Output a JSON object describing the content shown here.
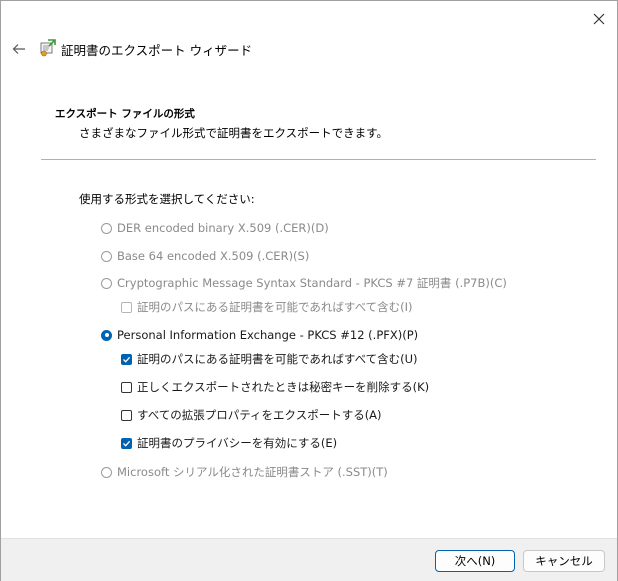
{
  "window": {
    "close_icon": "close-icon",
    "back_icon": "back-arrow-icon"
  },
  "header": {
    "icon": "certificate-export-icon",
    "title": "証明書のエクスポート ウィザード"
  },
  "section": {
    "title": "エクスポート ファイルの形式",
    "description": "さまざまなファイル形式で証明書をエクスポートできます。"
  },
  "prompt": "使用する形式を選択してください:",
  "options": {
    "der": {
      "label": "DER encoded binary X.509 (.CER)(D)",
      "selected": false,
      "enabled": false
    },
    "base64": {
      "label": "Base 64 encoded X.509 (.CER)(S)",
      "selected": false,
      "enabled": false
    },
    "pkcs7": {
      "label": "Cryptographic Message Syntax Standard - PKCS #7 証明書 (.P7B)(C)",
      "selected": false,
      "enabled": false
    },
    "pkcs7_include_path": {
      "label": "証明のパスにある証明書を可能であればすべて含む(I)",
      "checked": false,
      "enabled": false
    },
    "pfx": {
      "label": "Personal Information Exchange - PKCS #12 (.PFX)(P)",
      "selected": true,
      "enabled": true
    },
    "pfx_include_path": {
      "label": "証明のパスにある証明書を可能であればすべて含む(U)",
      "checked": true,
      "enabled": true
    },
    "pfx_delete_key": {
      "label": "正しくエクスポートされたときは秘密キーを削除する(K)",
      "checked": false,
      "enabled": true
    },
    "pfx_export_props": {
      "label": "すべての拡張プロパティをエクスポートする(A)",
      "checked": false,
      "enabled": true
    },
    "pfx_privacy": {
      "label": "証明書のプライバシーを有効にする(E)",
      "checked": true,
      "enabled": true
    },
    "sst": {
      "label": "Microsoft シリアル化された証明書ストア (.SST)(T)",
      "selected": false,
      "enabled": false
    }
  },
  "footer": {
    "next_label": "次へ(N)",
    "cancel_label": "キャンセル"
  },
  "colors": {
    "accent": "#0063b1",
    "footer_bg": "#f0f0f0",
    "disabled_text": "#8a8a8a"
  }
}
